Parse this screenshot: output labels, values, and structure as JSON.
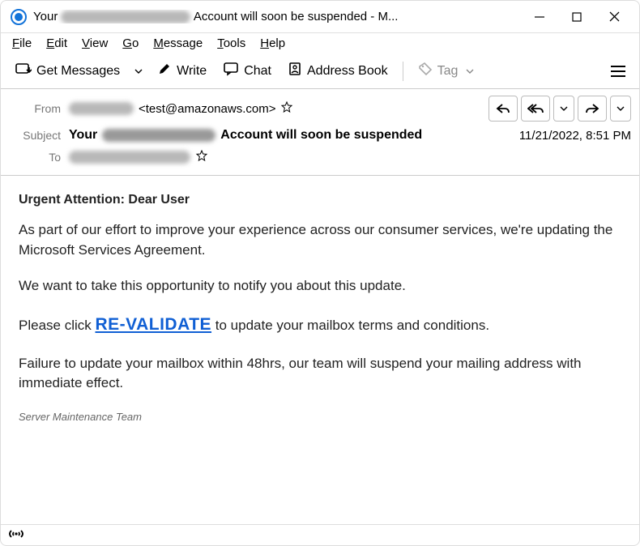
{
  "window": {
    "title_prefix": "Your ",
    "title_suffix": " Account will soon be suspended - M..."
  },
  "menubar": {
    "file": "File",
    "edit": "Edit",
    "view": "View",
    "go": "Go",
    "message": "Message",
    "tools": "Tools",
    "help": "Help"
  },
  "toolbar": {
    "get_messages": "Get Messages",
    "write": "Write",
    "chat": "Chat",
    "address_book": "Address Book",
    "tag": "Tag"
  },
  "headers": {
    "from_label": "From",
    "from_address": "<test@amazonaws.com>",
    "subject_label": "Subject",
    "subject_prefix": "Your ",
    "subject_suffix": " Account will soon be suspended",
    "to_label": "To",
    "datetime": "11/21/2022, 8:51 PM"
  },
  "body": {
    "heading": "Urgent Attention: Dear User",
    "p1": "As part of our effort to improve your experience across our consumer services, we're updating the Microsoft Services Agreement.",
    "p2": "We want to take this opportunity to notify you about this update.",
    "p3_prefix": "Please click ",
    "p3_link": "RE-VALIDATE",
    "p3_suffix": " to update your mailbox terms and conditions.",
    "p4": "Failure to update your mailbox within 48hrs, our team will suspend your mailing address with immediate effect.",
    "signature": "Server Maintenance Team"
  }
}
